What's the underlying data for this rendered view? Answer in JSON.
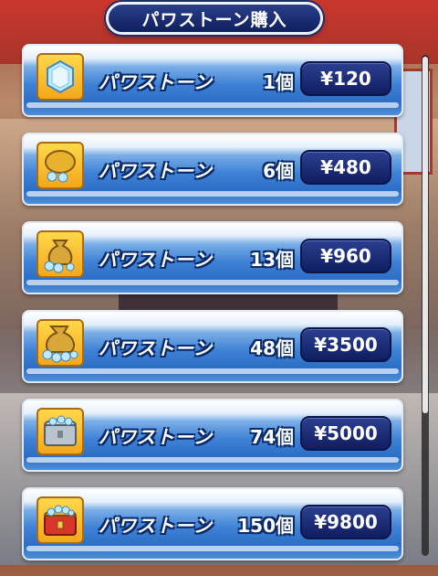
{
  "title": "パワストーン購入",
  "items": [
    {
      "name": "パワストーン",
      "qty": "1個",
      "price": "¥120",
      "icon": "diamond-icon"
    },
    {
      "name": "パワストーン",
      "qty": "6個",
      "price": "¥480",
      "icon": "small-bag-icon"
    },
    {
      "name": "パワストーン",
      "qty": "13個",
      "price": "¥960",
      "icon": "bag-icon"
    },
    {
      "name": "パワストーン",
      "qty": "48個",
      "price": "¥3500",
      "icon": "large-bag-icon"
    },
    {
      "name": "パワストーン",
      "qty": "74個",
      "price": "¥5000",
      "icon": "chest-icon"
    },
    {
      "name": "パワストーン",
      "qty": "150個",
      "price": "¥9800",
      "icon": "large-chest-icon"
    }
  ]
}
